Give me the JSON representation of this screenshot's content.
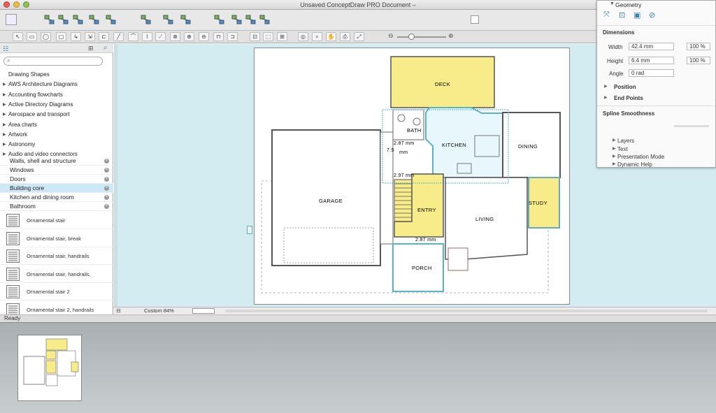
{
  "window": {
    "title": "Unsaved ConceptDraw PRO Document –"
  },
  "colors": {
    "room_highlight": "#f7eb8a",
    "canvas_bg": "#d2ecf2",
    "selected_row": "#cde8f6"
  },
  "sidebar": {
    "search_placeholder": "",
    "libraries": [
      "Drawing Shapes",
      "AWS Architecture Diagrams",
      "Accounting flowcharts",
      "Active Directory Diagrams",
      "Aerospace and transport",
      "Area charts",
      "Artwork",
      "Astronomy",
      "Audio and video connectors"
    ],
    "sublibraries": [
      "Walls, shell and structure",
      "Windows",
      "Doors",
      "Building core",
      "Kitchen and dining room",
      "Bathroom"
    ],
    "selected_sublibrary": "Building core",
    "shapes": [
      "Ornamental stair",
      "Ornamental stair, break",
      "Ornamental stair, handrails",
      "Ornamental stair, handrails,",
      "Ornamental stair 2",
      "Ornamental stair 2, handrails"
    ]
  },
  "plan": {
    "rooms": {
      "deck": "DECK",
      "bath": "BATH",
      "kitchen": "KITCHEN",
      "dining": "DINING",
      "garage": "GARAGE",
      "entry": "ENTRY",
      "living": "LIVING",
      "study": "STUDY",
      "porch": "PORCH"
    },
    "dims": {
      "d1": "2.87 mm",
      "d2": "7.5",
      "d3": "mm",
      "d4": "2.97 mm",
      "d5": "2.87 mm"
    }
  },
  "status": {
    "zoom": "Custom 84%",
    "ready": "Ready"
  },
  "properties": {
    "geometry_title": "Geometry",
    "dimensions_header": "Dimensions",
    "width_label": "Width",
    "width_value": "42.4 mm",
    "width_pct": "100 %",
    "height_label": "Height",
    "height_value": "6.4 mm",
    "height_pct": "100 %",
    "angle_label": "Angle",
    "angle_value": "0 rad",
    "position": "Position",
    "end_points": "End Points",
    "spline_header": "Spline Smoothness",
    "layers": "Layers",
    "text": "Text",
    "presentation_mode": "Presentation Mode",
    "dynamic_help": "Dynamic Help"
  }
}
